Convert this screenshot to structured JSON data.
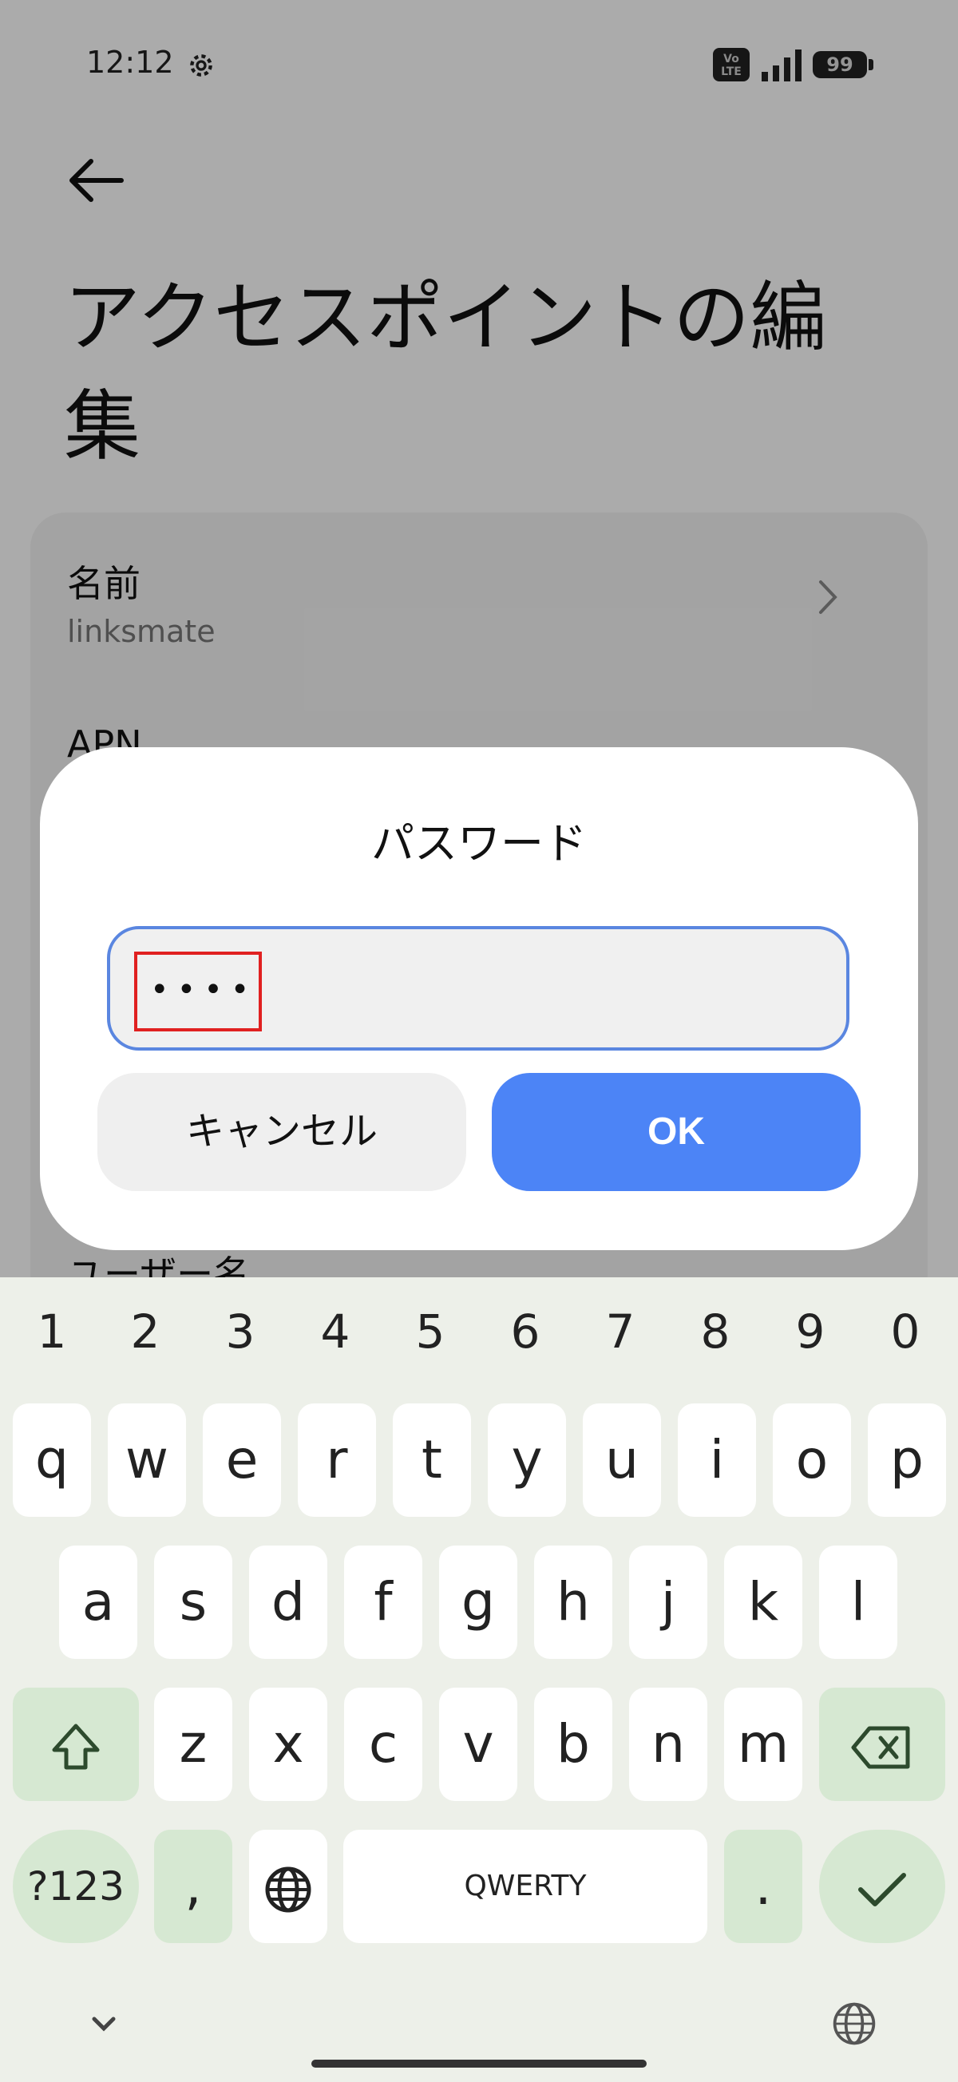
{
  "status_bar": {
    "time": "12:12",
    "volte": "Vo LTE",
    "battery": "99"
  },
  "page": {
    "title": "アクセスポイントの編集"
  },
  "settings_rows": [
    {
      "title": "名前",
      "value": "linksmate"
    },
    {
      "title": "APN",
      "value": ""
    },
    {
      "title": "ユーザー名",
      "value": ""
    }
  ],
  "dialog": {
    "title": "パスワード",
    "password_value": "••••",
    "cancel_label": "キャンセル",
    "ok_label": "OK"
  },
  "keyboard": {
    "numbers": [
      "1",
      "2",
      "3",
      "4",
      "5",
      "6",
      "7",
      "8",
      "9",
      "0"
    ],
    "row1": [
      "q",
      "w",
      "e",
      "r",
      "t",
      "y",
      "u",
      "i",
      "o",
      "p"
    ],
    "row2": [
      "a",
      "s",
      "d",
      "f",
      "g",
      "h",
      "j",
      "k",
      "l"
    ],
    "row3": [
      "z",
      "x",
      "c",
      "v",
      "b",
      "n",
      "m"
    ],
    "symbols_label": "?123",
    "comma": ",",
    "space_label": "QWERTY",
    "period": "."
  },
  "colors": {
    "accent": "#4c84f6",
    "keyboard_bg": "#edf0e9",
    "modifier_key": "#d6e8d2",
    "highlight_box": "#e02020"
  },
  "icons": [
    "gear-icon",
    "signal-icon",
    "battery-icon",
    "back-arrow-icon",
    "chevron-right-icon",
    "shift-icon",
    "backspace-icon",
    "globe-icon",
    "check-icon",
    "chevron-down-icon"
  ]
}
